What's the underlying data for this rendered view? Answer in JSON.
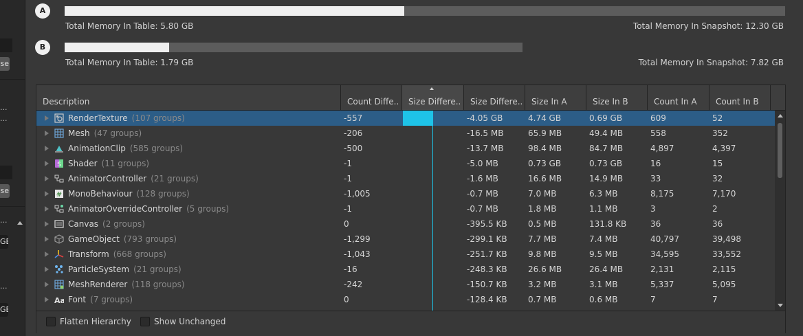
{
  "left_panel": {
    "button_fragments": [
      "se",
      "se"
    ],
    "dots": [
      "...",
      "...",
      "...",
      "..."
    ],
    "size_fragments": [
      "GB",
      "GB"
    ]
  },
  "snapshots": [
    {
      "badge": "A",
      "fill_fraction": 0.4715,
      "table_total": "Total Memory In Table: 5.80 GB",
      "snapshot_total": "Total Memory In Snapshot: 12.30 GB"
    },
    {
      "badge": "B",
      "fill_fraction": 0.2289,
      "table_total": "Total Memory In Table: 1.79 GB",
      "snapshot_total": "Total Memory In Snapshot: 7.82 GB"
    }
  ],
  "table": {
    "columns": [
      "Description",
      "Count Diffe...",
      "Size Differe...",
      "Size Differe...",
      "Size In A",
      "Size In B",
      "Count In A",
      "Count In B"
    ],
    "sorted_column": 2,
    "rows": [
      {
        "name": "RenderTexture",
        "groups": "(107 groups)",
        "icon": "render-texture-icon",
        "count_diff": "-557",
        "size_bar_fraction": 0.5,
        "size_diff": "-4.05 GB",
        "size_a": "4.74 GB",
        "size_b": "0.69 GB",
        "count_a": "609",
        "count_b": "52",
        "selected": true
      },
      {
        "name": "Mesh",
        "groups": "(47 groups)",
        "icon": "mesh-icon",
        "count_diff": "-206",
        "size_bar_fraction": 0,
        "size_diff": "-16.5 MB",
        "size_a": "65.9 MB",
        "size_b": "49.4 MB",
        "count_a": "558",
        "count_b": "352",
        "selected": false
      },
      {
        "name": "AnimationClip",
        "groups": "(585 groups)",
        "icon": "animation-clip-icon",
        "count_diff": "-500",
        "size_bar_fraction": 0,
        "size_diff": "-13.7 MB",
        "size_a": "98.4 MB",
        "size_b": "84.7 MB",
        "count_a": "4,897",
        "count_b": "4,397",
        "selected": false
      },
      {
        "name": "Shader",
        "groups": "(11 groups)",
        "icon": "shader-icon",
        "count_diff": "-1",
        "size_bar_fraction": 0,
        "size_diff": "-5.0 MB",
        "size_a": "0.73 GB",
        "size_b": "0.73 GB",
        "count_a": "16",
        "count_b": "15",
        "selected": false
      },
      {
        "name": "AnimatorController",
        "groups": "(21 groups)",
        "icon": "animator-controller-icon",
        "count_diff": "-1",
        "size_bar_fraction": 0,
        "size_diff": "-1.6 MB",
        "size_a": "16.6 MB",
        "size_b": "14.9 MB",
        "count_a": "33",
        "count_b": "32",
        "selected": false
      },
      {
        "name": "MonoBehaviour",
        "groups": "(128 groups)",
        "icon": "mono-behaviour-icon",
        "count_diff": "-1,005",
        "size_bar_fraction": 0,
        "size_diff": "-0.7 MB",
        "size_a": "7.0 MB",
        "size_b": "6.3 MB",
        "count_a": "8,175",
        "count_b": "7,170",
        "selected": false
      },
      {
        "name": "AnimatorOverrideController",
        "groups": "(5 groups)",
        "icon": "animator-override-controller-icon",
        "count_diff": "-1",
        "size_bar_fraction": 0,
        "size_diff": "-0.7 MB",
        "size_a": "1.8 MB",
        "size_b": "1.1 MB",
        "count_a": "3",
        "count_b": "2",
        "selected": false
      },
      {
        "name": "Canvas",
        "groups": "(2 groups)",
        "icon": "canvas-icon",
        "count_diff": "0",
        "size_bar_fraction": 0,
        "size_diff": "-395.5 KB",
        "size_a": "0.5 MB",
        "size_b": "131.8 KB",
        "count_a": "36",
        "count_b": "36",
        "selected": false
      },
      {
        "name": "GameObject",
        "groups": "(793 groups)",
        "icon": "game-object-icon",
        "count_diff": "-1,299",
        "size_bar_fraction": 0,
        "size_diff": "-299.1 KB",
        "size_a": "7.7 MB",
        "size_b": "7.4 MB",
        "count_a": "40,797",
        "count_b": "39,498",
        "selected": false
      },
      {
        "name": "Transform",
        "groups": "(668 groups)",
        "icon": "transform-icon",
        "count_diff": "-1,043",
        "size_bar_fraction": 0,
        "size_diff": "-251.7 KB",
        "size_a": "9.8 MB",
        "size_b": "9.5 MB",
        "count_a": "34,595",
        "count_b": "33,552",
        "selected": false
      },
      {
        "name": "ParticleSystem",
        "groups": "(21 groups)",
        "icon": "particle-system-icon",
        "count_diff": "-16",
        "size_bar_fraction": 0,
        "size_diff": "-248.3 KB",
        "size_a": "26.6 MB",
        "size_b": "26.4 MB",
        "count_a": "2,131",
        "count_b": "2,115",
        "selected": false
      },
      {
        "name": "MeshRenderer",
        "groups": "(118 groups)",
        "icon": "mesh-renderer-icon",
        "count_diff": "-242",
        "size_bar_fraction": 0,
        "size_diff": "-150.7 KB",
        "size_a": "3.2 MB",
        "size_b": "3.1 MB",
        "count_a": "5,337",
        "count_b": "5,095",
        "selected": false
      },
      {
        "name": "Font",
        "groups": "(7 groups)",
        "icon": "font-icon",
        "count_diff": "0",
        "size_bar_fraction": 0,
        "size_diff": "-128.4 KB",
        "size_a": "0.7 MB",
        "size_b": "0.6 MB",
        "count_a": "7",
        "count_b": "7",
        "selected": false
      }
    ]
  },
  "footer": {
    "flatten_hierarchy": "Flatten Hierarchy",
    "show_unchanged": "Show Unchanged",
    "flatten_checked": false,
    "unchanged_checked": false
  },
  "colors": {
    "selection": "#2c5d87",
    "size_bar": "#1ec3e8",
    "memory_bar_fill": "#efefef",
    "memory_bar_track": "#5c5c5c"
  }
}
